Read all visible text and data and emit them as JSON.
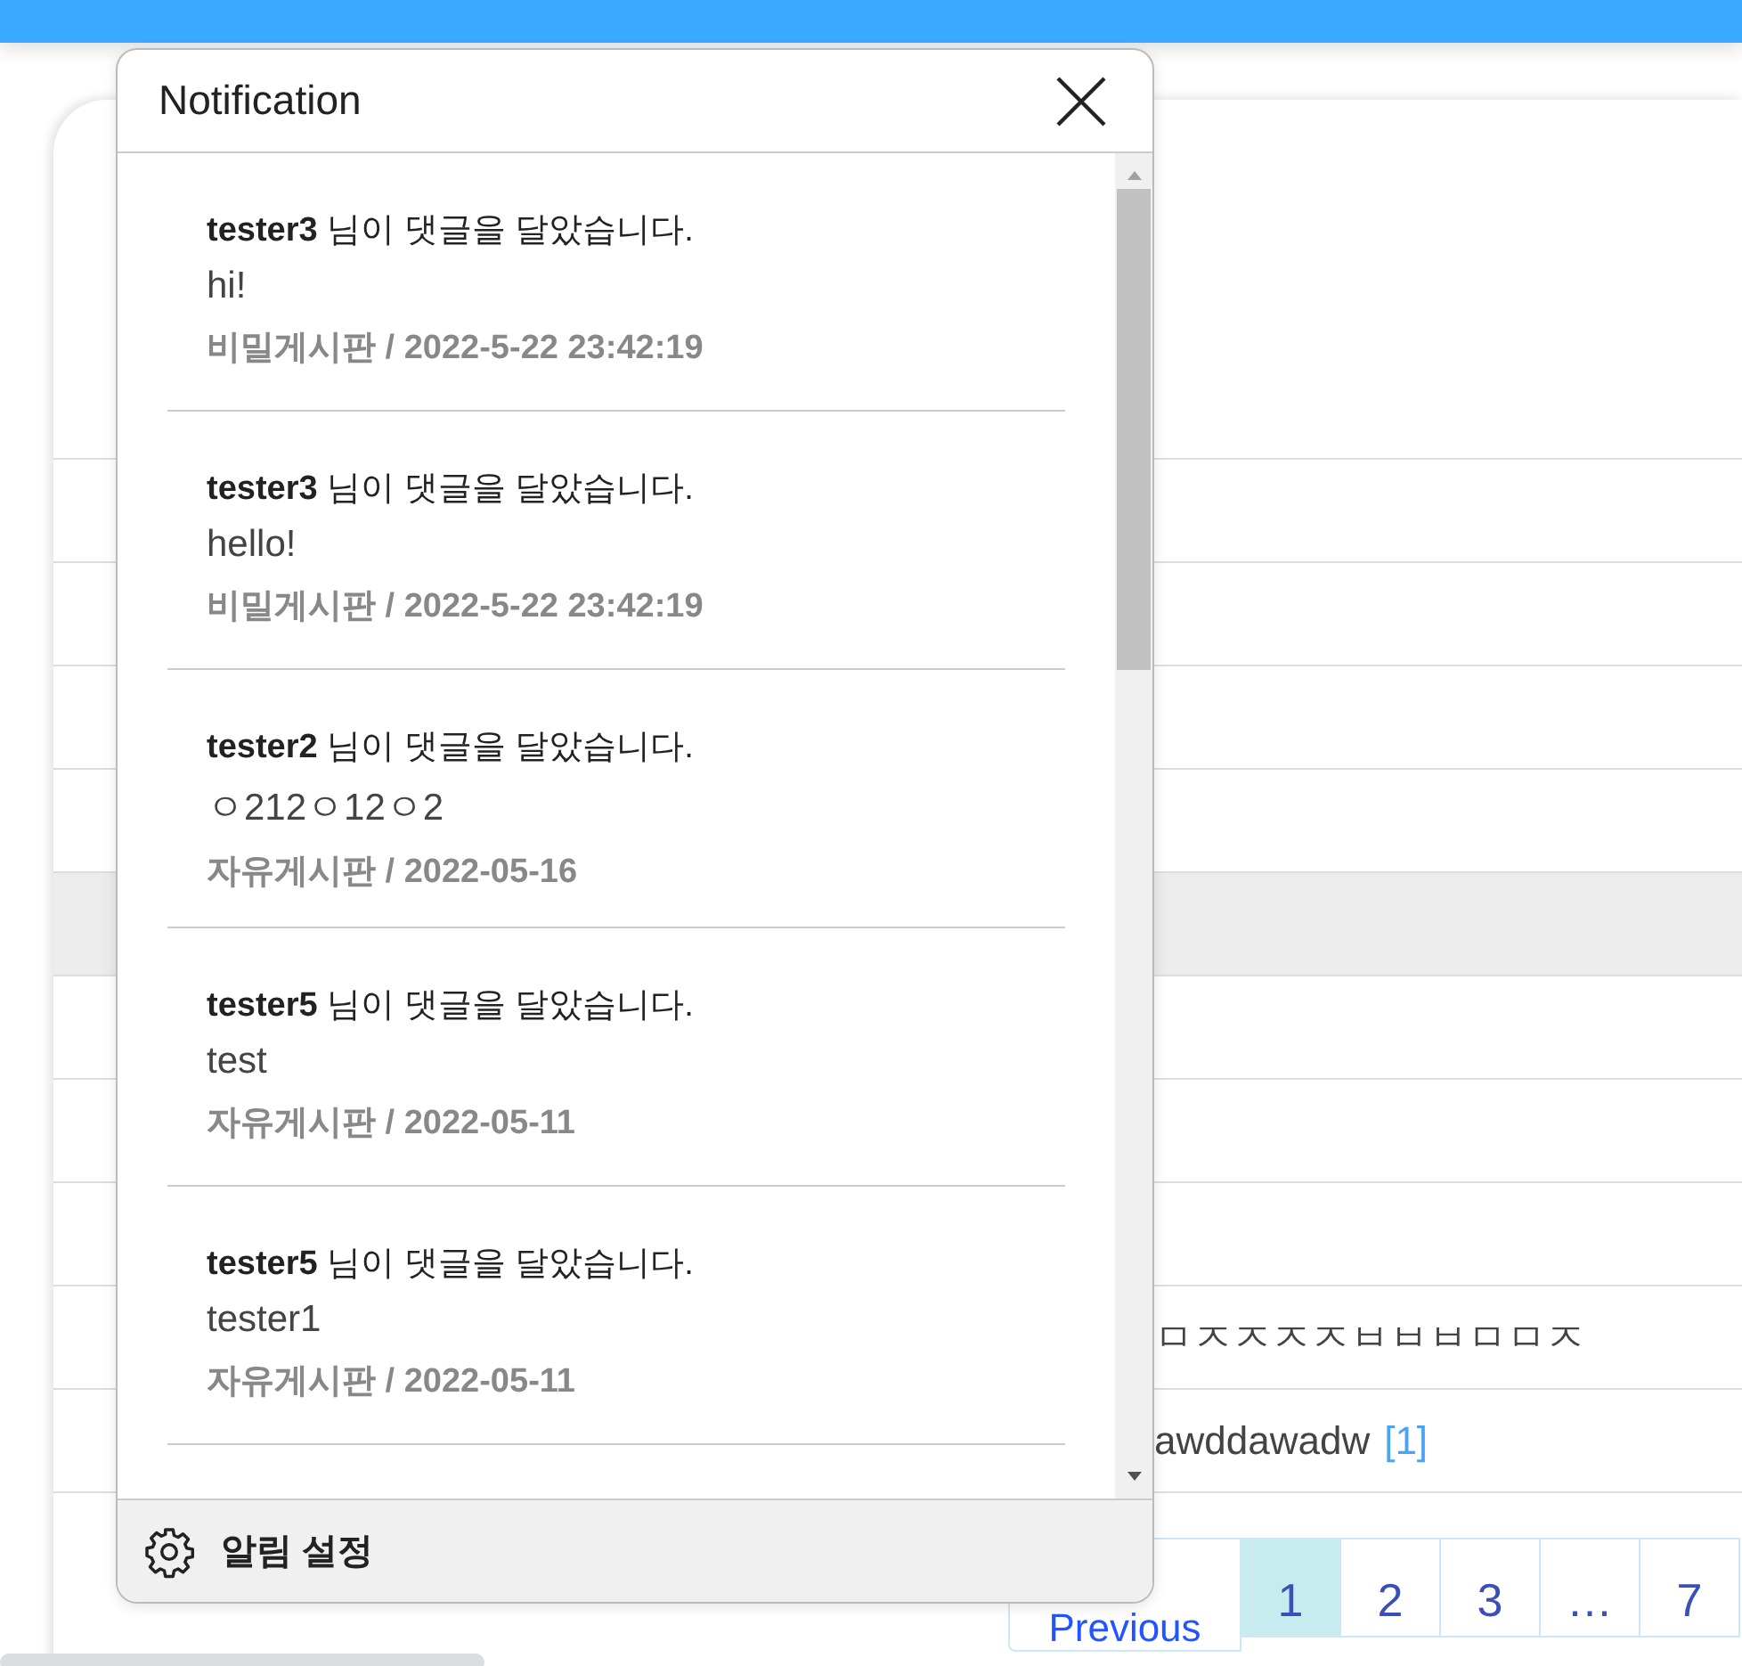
{
  "notification_panel": {
    "title": "Notification",
    "items": [
      {
        "user": "tester3",
        "message": "님이 댓글을 달았습니다.",
        "comment": "hi!",
        "meta": "비밀게시판 / 2022-5-22 23:42:19"
      },
      {
        "user": "tester3",
        "message": "님이 댓글을 달았습니다.",
        "comment": "hello!",
        "meta": "비밀게시판 / 2022-5-22 23:42:19"
      },
      {
        "user": "tester2",
        "message": "님이 댓글을 달았습니다.",
        "comment": "ㅇ212ㅇ12ㅇ2",
        "meta": "자유게시판 / 2022-05-16"
      },
      {
        "user": "tester5",
        "message": "님이 댓글을 달았습니다.",
        "comment": "test",
        "meta": "자유게시판 / 2022-05-11"
      },
      {
        "user": "tester5",
        "message": "님이 댓글을 달았습니다.",
        "comment": "tester1",
        "meta": "자유게시판 / 2022-05-11"
      }
    ],
    "settings_label": "알림 설정"
  },
  "rows": [
    {
      "highlighted": false
    },
    {
      "highlighted": false
    },
    {
      "highlighted": false
    },
    {
      "highlighted": false
    },
    {
      "highlighted": true
    },
    {
      "highlighted": false
    },
    {
      "highlighted": false
    },
    {
      "highlighted": false
    },
    {
      "highlighted": false,
      "title": "ㅁㅈㅈㅈㅈㅂㅂㅂㅁㅁㅈ"
    },
    {
      "highlighted": false,
      "title": "awddawadw",
      "comment_count": "[1]"
    }
  ],
  "pagination": [
    {
      "label": "Previous",
      "selected": false
    },
    {
      "label": "1",
      "selected": true
    },
    {
      "label": "2",
      "selected": false
    },
    {
      "label": "3",
      "selected": false
    },
    {
      "label": "…",
      "selected": false
    },
    {
      "label": "7",
      "selected": false
    }
  ]
}
